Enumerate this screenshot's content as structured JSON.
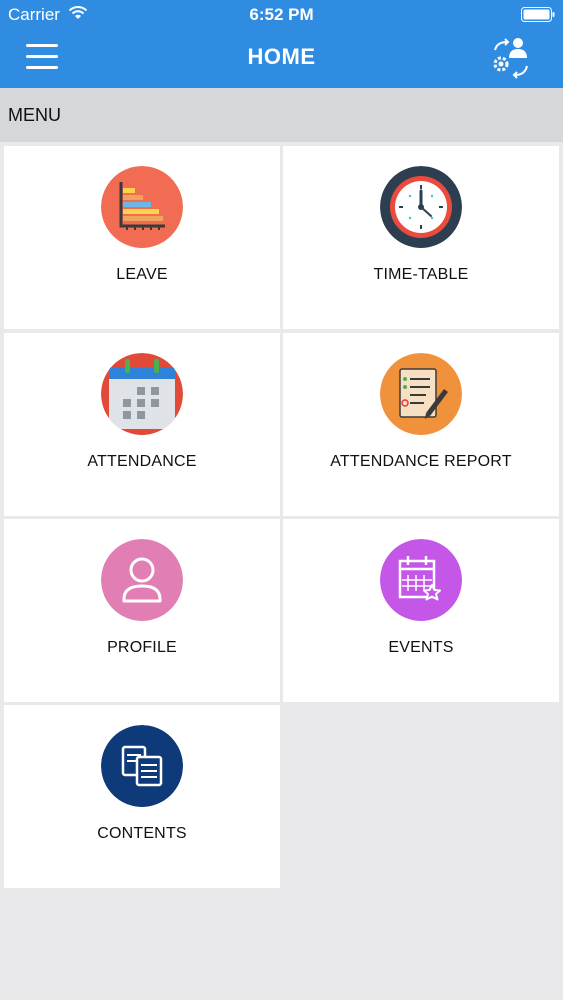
{
  "status_bar": {
    "carrier": "Carrier",
    "time": "6:52 PM"
  },
  "nav": {
    "title": "HOME",
    "menu_icon": "hamburger-icon",
    "switch_icon": "switch-user-icon"
  },
  "section": {
    "label": "MENU"
  },
  "menu_items": [
    {
      "label": "LEAVE",
      "icon": "leave-chart-icon",
      "color": "#f26b53"
    },
    {
      "label": "TIME-TABLE",
      "icon": "clock-icon",
      "color": "#2c3e50"
    },
    {
      "label": "ATTENDANCE",
      "icon": "calendar-icon",
      "color": "#e04a36"
    },
    {
      "label": "ATTENDANCE REPORT",
      "icon": "report-icon",
      "color": "#f0923b"
    },
    {
      "label": "PROFILE",
      "icon": "profile-icon",
      "color": "#e17fb4"
    },
    {
      "label": "EVENTS",
      "icon": "events-calendar-icon",
      "color": "#c457e8"
    },
    {
      "label": "CONTENTS",
      "icon": "contents-icon",
      "color": "#0e3a7a"
    }
  ],
  "colors": {
    "primary": "#2f8ce0",
    "section_bg": "#d6d7db",
    "page_bg": "#e9e8ea"
  }
}
